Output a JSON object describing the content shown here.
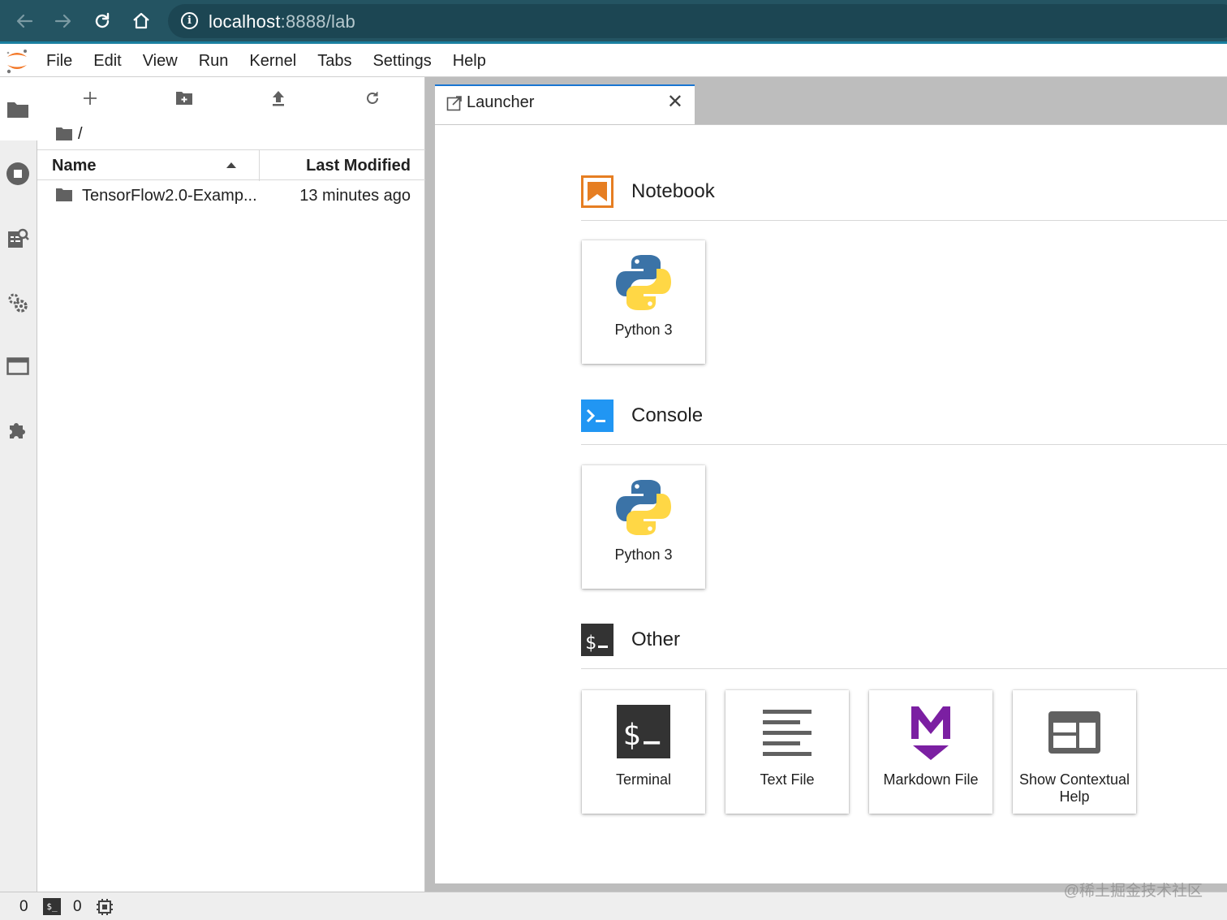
{
  "browser": {
    "url_host": "localhost",
    "url_rest": ":8888/lab"
  },
  "menu": [
    "File",
    "Edit",
    "View",
    "Run",
    "Kernel",
    "Tabs",
    "Settings",
    "Help"
  ],
  "filebrowser": {
    "breadcrumb": "/",
    "col_name": "Name",
    "col_modified": "Last Modified",
    "rows": [
      {
        "name": "TensorFlow2.0-Examp...",
        "modified": "13 minutes ago"
      }
    ]
  },
  "tab": {
    "label": "Launcher"
  },
  "launcher": {
    "notebook": {
      "title": "Notebook",
      "cards": [
        {
          "label": "Python 3"
        }
      ]
    },
    "console": {
      "title": "Console",
      "cards": [
        {
          "label": "Python 3"
        }
      ]
    },
    "other": {
      "title": "Other",
      "cards": [
        {
          "label": "Terminal"
        },
        {
          "label": "Text File"
        },
        {
          "label": "Markdown File"
        },
        {
          "label": "Show Contextual Help"
        }
      ]
    }
  },
  "status": {
    "terminals": "0",
    "kernels": "0"
  },
  "watermark": "@稀土掘金技术社区",
  "colors": {
    "accent": "#1976d2",
    "notebook_orange": "#e67e22",
    "markdown_purple": "#7b1fa2",
    "browser_bar": "#245462"
  }
}
